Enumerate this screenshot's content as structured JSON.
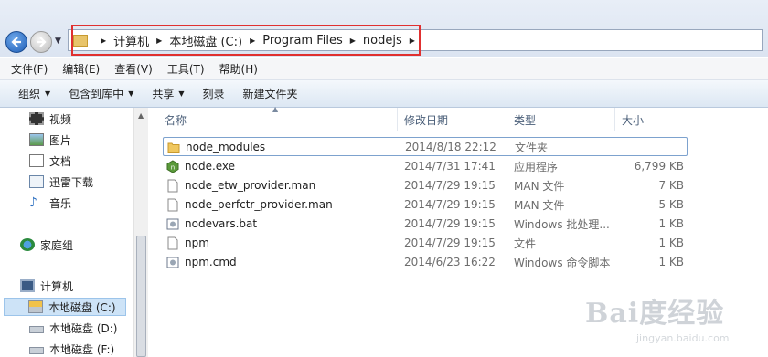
{
  "address": {
    "crumbs": [
      "计算机",
      "本地磁盘 (C:)",
      "Program Files",
      "nodejs"
    ]
  },
  "menu": [
    "文件(F)",
    "编辑(E)",
    "查看(V)",
    "工具(T)",
    "帮助(H)"
  ],
  "toolbar": {
    "organize": "组织",
    "include": "包含到库中",
    "share": "共享",
    "burn": "刻录",
    "new_folder": "新建文件夹"
  },
  "sidebar": {
    "libraries": [
      "视频",
      "图片",
      "文档",
      "迅雷下载",
      "音乐"
    ],
    "homegroup": "家庭组",
    "computer": "计算机",
    "drives": [
      "本地磁盘 (C:)",
      "本地磁盘 (D:)",
      "本地磁盘 (F:)"
    ]
  },
  "columns": {
    "name": "名称",
    "date": "修改日期",
    "type": "类型",
    "size": "大小"
  },
  "files": [
    {
      "name": "node_modules",
      "date": "2014/8/18 22:12",
      "type": "文件夹",
      "size": "",
      "icon": "folder-icon"
    },
    {
      "name": "node.exe",
      "date": "2014/7/31 17:41",
      "type": "应用程序",
      "size": "6,799 KB",
      "icon": "node-exe-icon"
    },
    {
      "name": "node_etw_provider.man",
      "date": "2014/7/29 19:15",
      "type": "MAN 文件",
      "size": "7 KB",
      "icon": "file-icon"
    },
    {
      "name": "node_perfctr_provider.man",
      "date": "2014/7/29 19:15",
      "type": "MAN 文件",
      "size": "5 KB",
      "icon": "file-icon"
    },
    {
      "name": "nodevars.bat",
      "date": "2014/7/29 19:15",
      "type": "Windows 批处理...",
      "size": "1 KB",
      "icon": "bat-icon"
    },
    {
      "name": "npm",
      "date": "2014/7/29 19:15",
      "type": "文件",
      "size": "1 KB",
      "icon": "file-icon"
    },
    {
      "name": "npm.cmd",
      "date": "2014/6/23 16:22",
      "type": "Windows 命令脚本",
      "size": "1 KB",
      "icon": "cmd-icon"
    }
  ],
  "watermark": {
    "logo": "Bai度经验",
    "url": "jingyan.baidu.com"
  }
}
